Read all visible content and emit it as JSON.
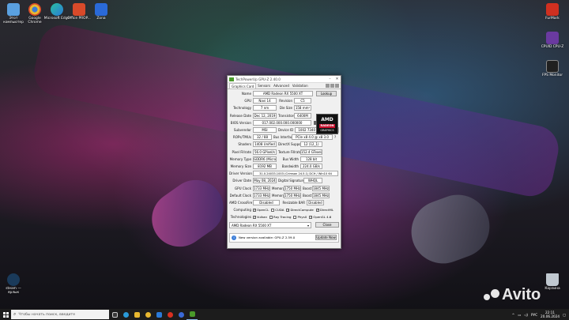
{
  "desktop": {
    "left_icons": [
      {
        "label": "Этот компьютер",
        "color": "#5aa0e0"
      },
      {
        "label": "Google Chrome",
        "color": "#e8b830"
      },
      {
        "label": "Microsoft Edge",
        "color": "#2a9ad8"
      },
      {
        "label": "Office PROP...",
        "color": "#d84a2a"
      },
      {
        "label": "Zona",
        "color": "#2a6ad8"
      }
    ],
    "right_icons": [
      {
        "label": "FurMark",
        "color": "#d03020"
      },
      {
        "label": "CPUID CPU-Z",
        "color": "#6a3aa0"
      },
      {
        "label": "FPS Monitor",
        "color": "#202020"
      }
    ],
    "steam_icon": {
      "label": "steam — ярлык",
      "color": "#1a3a5a"
    },
    "recycle_icon": {
      "label": "Корзина",
      "color": "#c0c8d0"
    },
    "watermark": "Avito"
  },
  "gpuz": {
    "title": "TechPowerUp GPU-Z 2.40.0",
    "tabs": [
      "Graphics Card",
      "Sensors",
      "Advanced",
      "Validation"
    ],
    "lookup_label": "Lookup",
    "name": "AMD Radeon RX 5500 XT",
    "gpu": "Navi 14",
    "revision": "C5",
    "technology": "7 nm",
    "die_size": "158 mm²",
    "release_date": "Dec 12, 2019",
    "transistors": "6400M",
    "bios_version": "017.002.000.000.000000",
    "uefi_label": "UEFI",
    "subvendor": "MSI",
    "device_id": "1002 7340 - 1462 3822",
    "rops_tmus": "32 / 88",
    "bus_interface": "PCIe x8 4.0 @ x8 3.0",
    "shaders": "1408 Unified",
    "directx_support": "12 (12_1)",
    "pixel_fillrate": "56.0 GPixel/s",
    "texture_fillrate": "152.4 GTexel/s",
    "memory_type": "GDDR6 (Micron)",
    "bus_width": "128 bit",
    "memory_size": "8192 MB",
    "bandwidth": "224.0 GB/s",
    "driver_version": "31.0.24033.1003 (Crimson 24.5.1) DCH / Win10 64",
    "driver_date": "May 08, 2024",
    "digital_signature": "WHQL",
    "gpu_clock": "1733 MHz",
    "gpu_memory": "1750 MHz",
    "gpu_boost": "1845 MHz",
    "default_clock": "1733 MHz",
    "default_memory": "1750 MHz",
    "default_boost": "1845 MHz",
    "crossfire": "Disabled",
    "resizable_bar": "Disabled",
    "computing": [
      "OpenCL",
      "CUDA",
      "DirectCompute",
      "DirectML"
    ],
    "computing_checked": [
      "✓",
      "",
      "✓",
      "✓"
    ],
    "technologies": [
      "Vulkan",
      "Ray Tracing",
      "PhysX",
      "OpenGL 4.6"
    ],
    "technologies_checked": [
      "✓",
      "",
      "",
      "✓"
    ],
    "selected_card": "AMD Radeon RX 5500 XT",
    "close_label": "Close",
    "notification": "New version available: GPU-Z 2.59.0",
    "update_label": "Update Now",
    "amd_logo": {
      "brand": "AMD",
      "line1": "RADEON",
      "line2": "GRAPHICS"
    },
    "labels": {
      "name": "Name",
      "gpu": "GPU",
      "revision": "Revision",
      "technology": "Technology",
      "die_size": "Die Size",
      "release_date": "Release Date",
      "transistors": "Transistors",
      "bios_version": "BIOS Version",
      "subvendor": "Subvendor",
      "device_id": "Device ID",
      "rops_tmus": "ROPs/TMUs",
      "bus_interface": "Bus Interface",
      "shaders": "Shaders",
      "directx_support": "DirectX Support",
      "pixel_fillrate": "Pixel Fillrate",
      "texture_fillrate": "Texture Fillrate",
      "memory_type": "Memory Type",
      "bus_width": "Bus Width",
      "memory_size": "Memory Size",
      "bandwidth": "Bandwidth",
      "driver_version": "Driver Version",
      "driver_date": "Driver Date",
      "digital_signature": "Digital Signature",
      "gpu_clock": "GPU Clock",
      "memory": "Memory",
      "boost": "Boost",
      "default_clock": "Default Clock",
      "crossfire": "AMD CrossFire",
      "resizable_bar": "Resizable BAR",
      "computing": "Computing",
      "technologies": "Technologies"
    }
  },
  "taskbar": {
    "search_placeholder": "Чтобы начать поиск, введите",
    "apps": [
      {
        "color": "#3a3a3a"
      },
      {
        "color": "#2a9ad8"
      },
      {
        "color": "#e8b830"
      },
      {
        "color": "#e8b830"
      },
      {
        "color": "#2a7ad8"
      },
      {
        "color": "#d83020"
      },
      {
        "color": "#3a6ad8"
      },
      {
        "color": "#4a9a2a"
      }
    ],
    "language": "РУС",
    "time": "22:11",
    "date": "20.06.2024"
  }
}
